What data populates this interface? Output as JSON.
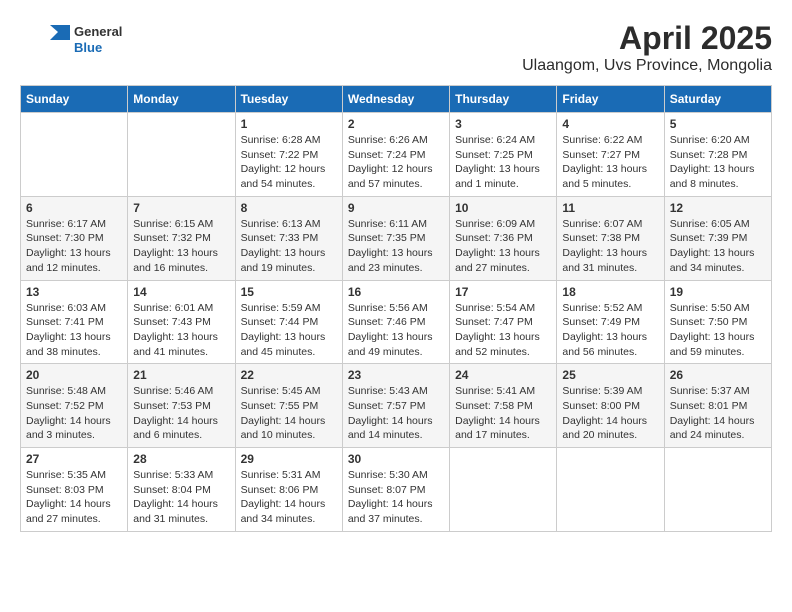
{
  "header": {
    "logo_line1": "General",
    "logo_line2": "Blue",
    "title": "April 2025",
    "subtitle": "Ulaangom, Uvs Province, Mongolia"
  },
  "calendar": {
    "days_of_week": [
      "Sunday",
      "Monday",
      "Tuesday",
      "Wednesday",
      "Thursday",
      "Friday",
      "Saturday"
    ],
    "weeks": [
      [
        {
          "day": "",
          "info": ""
        },
        {
          "day": "",
          "info": ""
        },
        {
          "day": "1",
          "info": "Sunrise: 6:28 AM\nSunset: 7:22 PM\nDaylight: 12 hours and 54 minutes."
        },
        {
          "day": "2",
          "info": "Sunrise: 6:26 AM\nSunset: 7:24 PM\nDaylight: 12 hours and 57 minutes."
        },
        {
          "day": "3",
          "info": "Sunrise: 6:24 AM\nSunset: 7:25 PM\nDaylight: 13 hours and 1 minute."
        },
        {
          "day": "4",
          "info": "Sunrise: 6:22 AM\nSunset: 7:27 PM\nDaylight: 13 hours and 5 minutes."
        },
        {
          "day": "5",
          "info": "Sunrise: 6:20 AM\nSunset: 7:28 PM\nDaylight: 13 hours and 8 minutes."
        }
      ],
      [
        {
          "day": "6",
          "info": "Sunrise: 6:17 AM\nSunset: 7:30 PM\nDaylight: 13 hours and 12 minutes."
        },
        {
          "day": "7",
          "info": "Sunrise: 6:15 AM\nSunset: 7:32 PM\nDaylight: 13 hours and 16 minutes."
        },
        {
          "day": "8",
          "info": "Sunrise: 6:13 AM\nSunset: 7:33 PM\nDaylight: 13 hours and 19 minutes."
        },
        {
          "day": "9",
          "info": "Sunrise: 6:11 AM\nSunset: 7:35 PM\nDaylight: 13 hours and 23 minutes."
        },
        {
          "day": "10",
          "info": "Sunrise: 6:09 AM\nSunset: 7:36 PM\nDaylight: 13 hours and 27 minutes."
        },
        {
          "day": "11",
          "info": "Sunrise: 6:07 AM\nSunset: 7:38 PM\nDaylight: 13 hours and 31 minutes."
        },
        {
          "day": "12",
          "info": "Sunrise: 6:05 AM\nSunset: 7:39 PM\nDaylight: 13 hours and 34 minutes."
        }
      ],
      [
        {
          "day": "13",
          "info": "Sunrise: 6:03 AM\nSunset: 7:41 PM\nDaylight: 13 hours and 38 minutes."
        },
        {
          "day": "14",
          "info": "Sunrise: 6:01 AM\nSunset: 7:43 PM\nDaylight: 13 hours and 41 minutes."
        },
        {
          "day": "15",
          "info": "Sunrise: 5:59 AM\nSunset: 7:44 PM\nDaylight: 13 hours and 45 minutes."
        },
        {
          "day": "16",
          "info": "Sunrise: 5:56 AM\nSunset: 7:46 PM\nDaylight: 13 hours and 49 minutes."
        },
        {
          "day": "17",
          "info": "Sunrise: 5:54 AM\nSunset: 7:47 PM\nDaylight: 13 hours and 52 minutes."
        },
        {
          "day": "18",
          "info": "Sunrise: 5:52 AM\nSunset: 7:49 PM\nDaylight: 13 hours and 56 minutes."
        },
        {
          "day": "19",
          "info": "Sunrise: 5:50 AM\nSunset: 7:50 PM\nDaylight: 13 hours and 59 minutes."
        }
      ],
      [
        {
          "day": "20",
          "info": "Sunrise: 5:48 AM\nSunset: 7:52 PM\nDaylight: 14 hours and 3 minutes."
        },
        {
          "day": "21",
          "info": "Sunrise: 5:46 AM\nSunset: 7:53 PM\nDaylight: 14 hours and 6 minutes."
        },
        {
          "day": "22",
          "info": "Sunrise: 5:45 AM\nSunset: 7:55 PM\nDaylight: 14 hours and 10 minutes."
        },
        {
          "day": "23",
          "info": "Sunrise: 5:43 AM\nSunset: 7:57 PM\nDaylight: 14 hours and 14 minutes."
        },
        {
          "day": "24",
          "info": "Sunrise: 5:41 AM\nSunset: 7:58 PM\nDaylight: 14 hours and 17 minutes."
        },
        {
          "day": "25",
          "info": "Sunrise: 5:39 AM\nSunset: 8:00 PM\nDaylight: 14 hours and 20 minutes."
        },
        {
          "day": "26",
          "info": "Sunrise: 5:37 AM\nSunset: 8:01 PM\nDaylight: 14 hours and 24 minutes."
        }
      ],
      [
        {
          "day": "27",
          "info": "Sunrise: 5:35 AM\nSunset: 8:03 PM\nDaylight: 14 hours and 27 minutes."
        },
        {
          "day": "28",
          "info": "Sunrise: 5:33 AM\nSunset: 8:04 PM\nDaylight: 14 hours and 31 minutes."
        },
        {
          "day": "29",
          "info": "Sunrise: 5:31 AM\nSunset: 8:06 PM\nDaylight: 14 hours and 34 minutes."
        },
        {
          "day": "30",
          "info": "Sunrise: 5:30 AM\nSunset: 8:07 PM\nDaylight: 14 hours and 37 minutes."
        },
        {
          "day": "",
          "info": ""
        },
        {
          "day": "",
          "info": ""
        },
        {
          "day": "",
          "info": ""
        }
      ]
    ]
  }
}
